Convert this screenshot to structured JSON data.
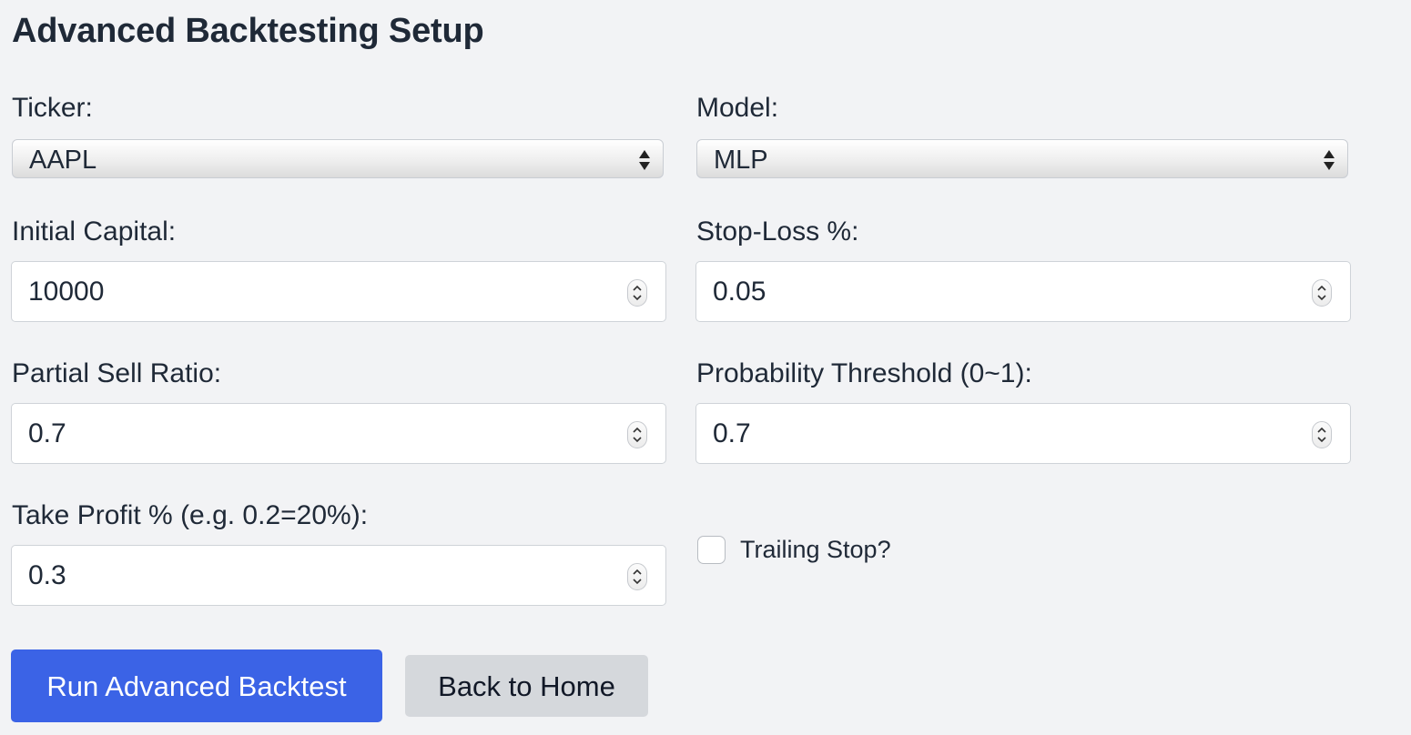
{
  "page": {
    "title": "Advanced Backtesting Setup"
  },
  "form": {
    "ticker": {
      "label": "Ticker:",
      "value": "AAPL"
    },
    "model": {
      "label": "Model:",
      "value": "MLP"
    },
    "initial_capital": {
      "label": "Initial Capital:",
      "value": "10000"
    },
    "stop_loss": {
      "label": "Stop-Loss %:",
      "value": "0.05"
    },
    "partial_sell_ratio": {
      "label": "Partial Sell Ratio:",
      "value": "0.7"
    },
    "probability_threshold": {
      "label": "Probability Threshold (0~1):",
      "value": "0.7"
    },
    "take_profit": {
      "label": "Take Profit % (e.g. 0.2=20%):",
      "value": "0.3"
    },
    "trailing_stop": {
      "label": "Trailing Stop?",
      "checked": false
    }
  },
  "actions": {
    "run_label": "Run Advanced Backtest",
    "home_label": "Back to Home"
  },
  "colors": {
    "background": "#f2f3f5",
    "primary_button": "#3b63e6",
    "secondary_button": "#d5d8dc",
    "text": "#1f2937"
  },
  "icons": {
    "select_arrows": "select-arrows-icon",
    "spinner": "spinner-arrows-icon"
  }
}
